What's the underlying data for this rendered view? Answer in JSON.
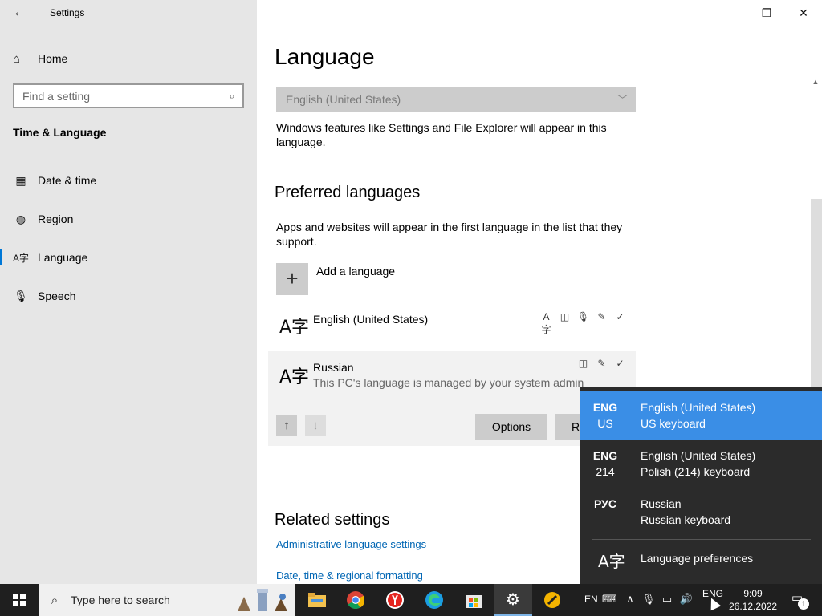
{
  "window": {
    "title": "Settings",
    "controls": {
      "minimize": "—",
      "maximize": "❐",
      "close": "✕"
    }
  },
  "sidebar": {
    "back_icon": "back-arrow-icon",
    "home": {
      "label": "Home",
      "icon": "home-icon"
    },
    "search": {
      "placeholder": "Find a setting",
      "icon": "search-icon"
    },
    "section_title": "Time & Language",
    "items": [
      {
        "label": "Date & time",
        "icon": "calendar-clock-icon",
        "selected": false
      },
      {
        "label": "Region",
        "icon": "globe-icon",
        "selected": false
      },
      {
        "label": "Language",
        "icon": "language-icon",
        "selected": true
      },
      {
        "label": "Speech",
        "icon": "microphone-icon",
        "selected": false
      }
    ]
  },
  "main": {
    "title": "Language",
    "display_language": {
      "value": "English (United States)",
      "note": "Windows features like Settings and File Explorer will appear in this language."
    },
    "preferred": {
      "heading": "Preferred languages",
      "description": "Apps and websites will appear in the first language in the list that they support.",
      "add_label": "Add a language",
      "languages": [
        {
          "name": "English (United States)",
          "subtitle": "",
          "features": [
            "display-language-icon",
            "speech-icon",
            "microphone-icon",
            "handwriting-icon",
            "spellcheck-icon"
          ]
        },
        {
          "name": "Russian",
          "subtitle": "This PC's language is managed by your system admin",
          "features": [
            "speech-icon",
            "handwriting-icon",
            "spellcheck-icon"
          ]
        }
      ],
      "options_label": "Options",
      "remove_label_partial": "Re"
    },
    "related": {
      "heading": "Related settings",
      "links": [
        "Administrative language settings",
        "Date, time & regional formatting"
      ]
    }
  },
  "flyout": {
    "items": [
      {
        "code1": "ENG",
        "code2": "US",
        "lang": "English (United States)",
        "keyboard": "US keyboard",
        "active": true
      },
      {
        "code1": "ENG",
        "code2": "214",
        "lang": "English (United States)",
        "keyboard": "Polish (214) keyboard",
        "active": false
      },
      {
        "code1": "РУС",
        "code2": "",
        "lang": "Russian",
        "keyboard": "Russian keyboard",
        "active": false
      }
    ],
    "preferences_label": "Language preferences"
  },
  "taskbar": {
    "search_placeholder": "Type here to search",
    "apps": [
      "file-explorer-icon",
      "chrome-icon",
      "yandex-browser-icon",
      "edge-icon",
      "microsoft-store-icon",
      "settings-icon",
      "sticky-app-icon"
    ],
    "tray": {
      "input_indicator": "EN",
      "language": "ENG",
      "time": "9:09",
      "date": "26.12.2022",
      "notification_count": "1"
    }
  },
  "colors": {
    "accent": "#0078d7",
    "flyout_active": "#3a8ee6",
    "link": "#0066b4",
    "sidebar_bg": "#e6e6e6",
    "taskbar_bg": "#1f1f1f"
  }
}
